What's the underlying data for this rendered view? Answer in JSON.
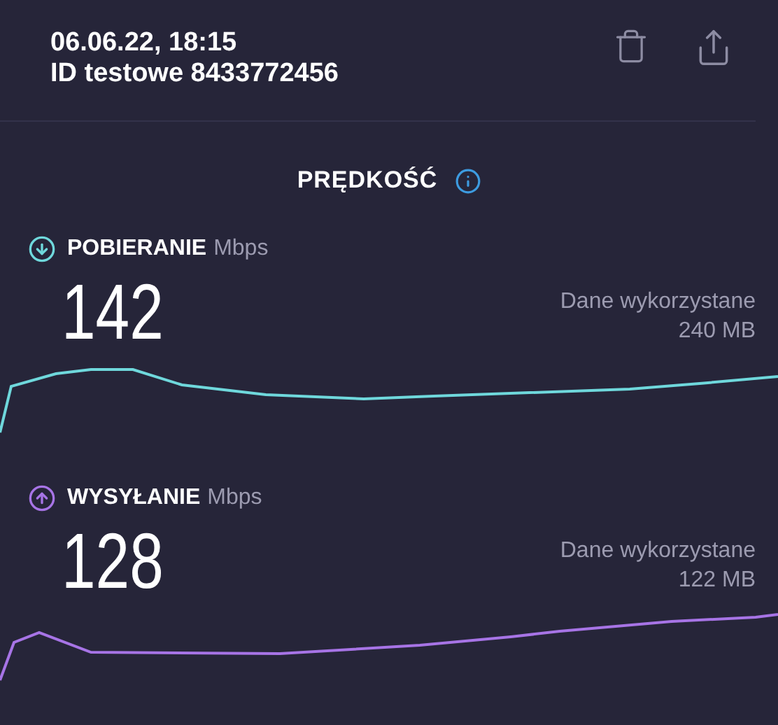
{
  "header": {
    "date": "06.06.22, 18:15",
    "test_id": "ID testowe 8433772456"
  },
  "section_title": "PRĘDKOŚĆ",
  "metrics": [
    {
      "kind": "download",
      "label": "POBIERANIE",
      "unit": "Mbps",
      "value": "142",
      "data_label": "Dane wykorzystane",
      "data_value": "240 MB",
      "color": "#6fd8dc"
    },
    {
      "kind": "upload",
      "label": "WYSYŁANIE",
      "unit": "Mbps",
      "value": "128",
      "data_label": "Dane wykorzystane",
      "data_value": "122 MB",
      "color": "#a774e6"
    }
  ]
}
